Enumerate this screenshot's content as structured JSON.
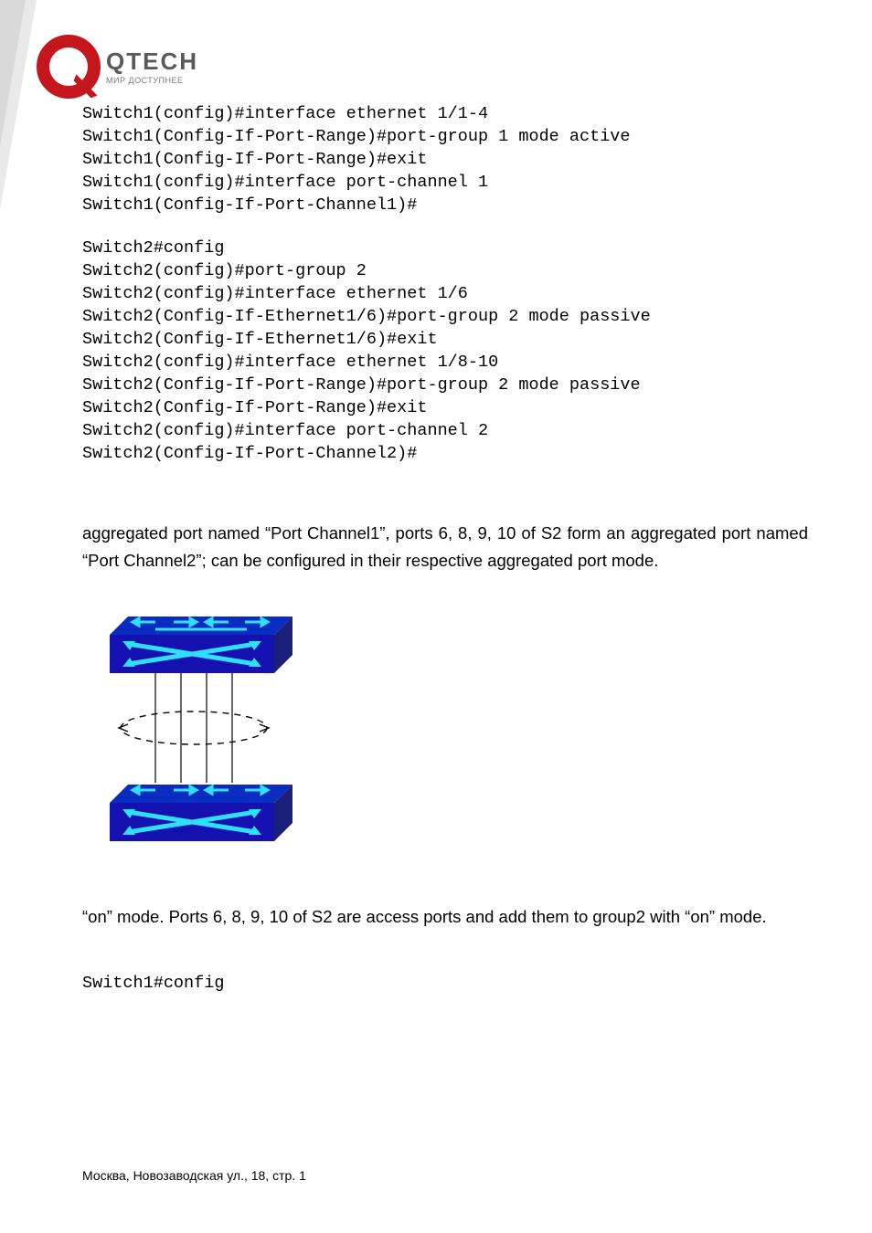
{
  "logo": {
    "brand": "QTECH",
    "tagline": "МИР ДОСТУПНЕЕ"
  },
  "code1": "Switch1(config)#interface ethernet 1/1-4\nSwitch1(Config-If-Port-Range)#port-group 1 mode active\nSwitch1(Config-If-Port-Range)#exit\nSwitch1(config)#interface port-channel 1\nSwitch1(Config-If-Port-Channel1)#",
  "code2": "Switch2#config\nSwitch2(config)#port-group 2\nSwitch2(config)#interface ethernet 1/6\nSwitch2(Config-If-Ethernet1/6)#port-group 2 mode passive\nSwitch2(Config-If-Ethernet1/6)#exit\nSwitch2(config)#interface ethernet 1/8-10\nSwitch2(Config-If-Port-Range)#port-group 2 mode passive\nSwitch2(Config-If-Port-Range)#exit\nSwitch2(config)#interface port-channel 2\nSwitch2(Config-If-Port-Channel2)#",
  "para1": "aggregated port named “Port Channel1”, ports 6, 8, 9, 10 of S2 form an aggregated port named “Port Channel2”; can be configured in their respective aggregated port mode.",
  "para2": "“on” mode. Ports 6, 8, 9, 10 of S2 are access ports and add them to group2 with “on” mode.",
  "code3": "Switch1#config",
  "footer": "Москва, Новозаводская ул., 18, стр. 1"
}
